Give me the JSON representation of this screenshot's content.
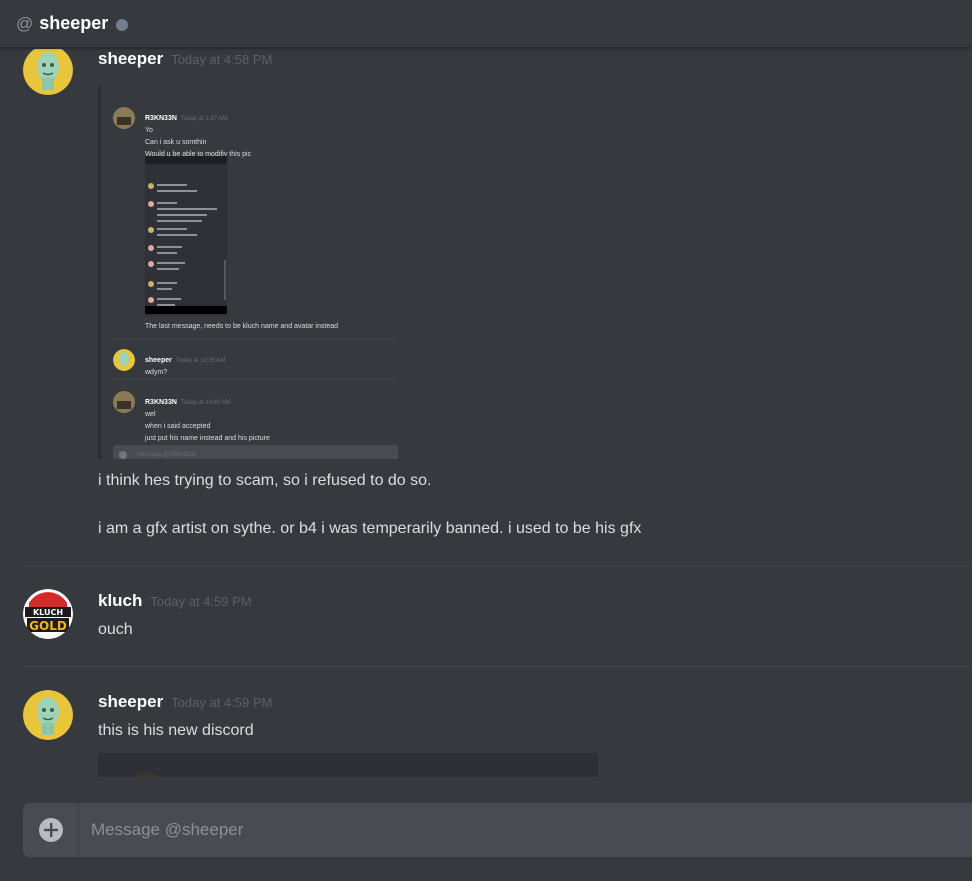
{
  "header": {
    "at_symbol": "@",
    "title": "sheeper",
    "status_color": "#747f8d"
  },
  "messages": [
    {
      "username": "sheeper",
      "timestamp": "Today at 4:58 PM",
      "lines": [
        "i think hes trying to scam, so i refused to do so.",
        "i am a gfx artist on sythe. or b4 i was temperarily banned. i used to be his gfx"
      ],
      "embedded_screenshot": {
        "m1_user": "R3KN33N",
        "m1_time": "Today at 1:37 AM",
        "m1_lines": [
          "Yo",
          "Can i ask u somthin",
          "Would u be able to modifiy this pic"
        ],
        "m1_caption": "The last message, needs to be kluch name and avatar instead",
        "m2_user": "sheeper",
        "m2_time": "Today at 10:35 AM",
        "m2_lines": [
          "wdym?"
        ],
        "m3_user": "R3KN33N",
        "m3_time": "Today at 10:40 AM",
        "m3_lines": [
          "wel",
          "when i said accepted",
          "just put his name instead and his picture"
        ],
        "input_placeholder": "Message @R3KN33N"
      }
    },
    {
      "username": "kluch",
      "timestamp": "Today at 4:59 PM",
      "lines": [
        "ouch"
      ],
      "avatar_text_top": "KLUCH",
      "avatar_text_bottom": "GOLD"
    },
    {
      "username": "sheeper",
      "timestamp": "Today at 4:59 PM",
      "lines": [
        "this is his new discord"
      ]
    }
  ],
  "composer": {
    "placeholder": "Message @sheeper"
  },
  "icons": {
    "at": "at-icon",
    "status": "status-dot-icon",
    "add": "add-attachment-icon"
  },
  "colors": {
    "background": "#36393e",
    "username": "#ffffff",
    "timestamp": "#5d6066",
    "composer": "#484b51"
  }
}
